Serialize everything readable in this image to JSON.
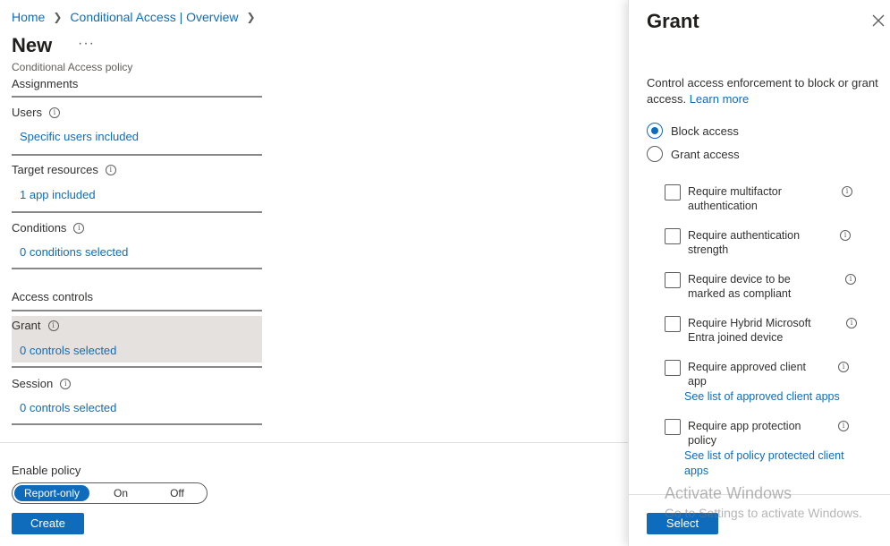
{
  "breadcrumb": {
    "home": "Home",
    "overview": "Conditional Access | Overview",
    "sep": ">"
  },
  "page": {
    "title": "New",
    "more": "···",
    "subtitle": "Conditional Access policy"
  },
  "assignments": {
    "heading": "Assignments",
    "users": {
      "label": "Users",
      "value": "Specific users included"
    },
    "target": {
      "label": "Target resources",
      "value": "1 app included"
    },
    "conditions": {
      "label": "Conditions",
      "value": "0 conditions selected"
    }
  },
  "access_controls": {
    "heading": "Access controls",
    "grant": {
      "label": "Grant",
      "value": "0 controls selected"
    },
    "session": {
      "label": "Session",
      "value": "0 controls selected"
    }
  },
  "enable_policy": {
    "label": "Enable policy",
    "options": [
      "Report-only",
      "On",
      "Off"
    ],
    "selected": "Report-only"
  },
  "create_label": "Create",
  "panel": {
    "title": "Grant",
    "description": "Control access enforcement to block or grant access.",
    "learn_more": "Learn more",
    "radios": [
      {
        "label": "Block access",
        "selected": true
      },
      {
        "label": "Grant access",
        "selected": false
      }
    ],
    "checkboxes": [
      {
        "label": "Require multifactor authentication",
        "checked": false
      },
      {
        "label": "Require authentication strength",
        "checked": false
      },
      {
        "label": "Require device to be marked as compliant",
        "checked": false
      },
      {
        "label": "Require Hybrid Microsoft Entra joined device",
        "checked": false
      },
      {
        "label": "Require approved client app",
        "checked": false,
        "link": "See list of approved client apps"
      },
      {
        "label": "Require app protection policy",
        "checked": false,
        "link": "See list of policy protected client apps"
      }
    ],
    "select_label": "Select"
  },
  "watermark": {
    "title": "Activate Windows",
    "subtitle": "Go to Settings to activate Windows."
  },
  "colors": {
    "accent": "#0f6cbd",
    "selected_row": "#e5e1de"
  }
}
